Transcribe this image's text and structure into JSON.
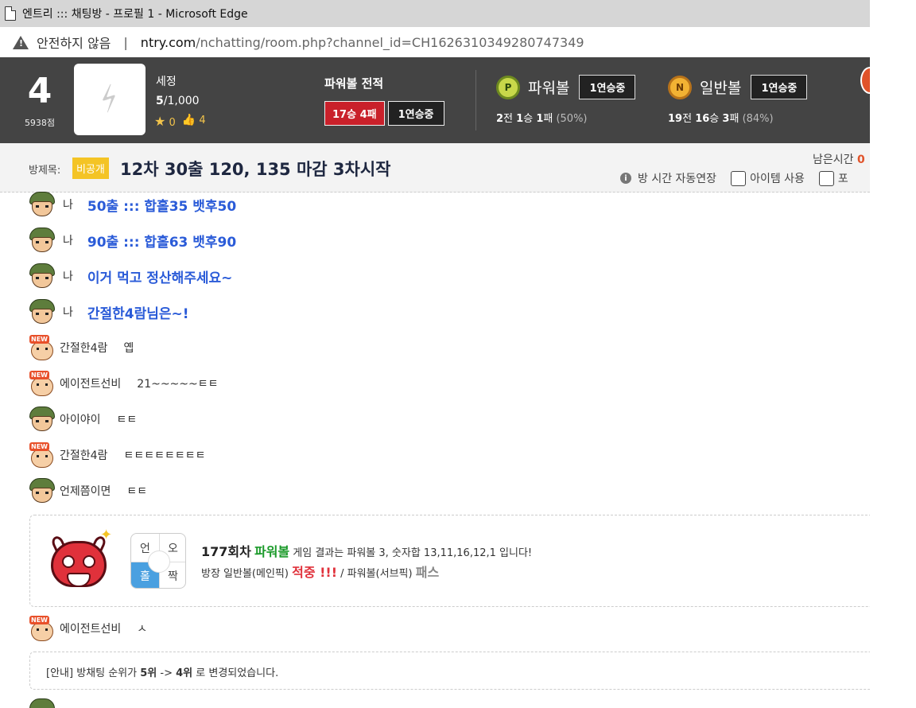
{
  "browser": {
    "window_title": "엔트리 ::: 채팅방 - 프로필 1 - Microsoft Edge",
    "security_label": "안전하지 않음",
    "separator": "|",
    "url_host": "ntry.com",
    "url_path": "/nchatting/room.php?channel_id=CH1626310349280747349"
  },
  "header": {
    "level": "4",
    "points": "5938점",
    "username": "세정",
    "count_current": "5",
    "count_rest": "/1,000",
    "stars": "0",
    "likes": "4",
    "powerball_record_title": "파워볼 전적",
    "powerball_record": "17승 4패",
    "powerball_streak": "1연승중",
    "games": [
      {
        "name": "파워볼",
        "coin": "P",
        "streak": "1연승중",
        "games": "2",
        "games_suffix": "전",
        "wins": "1",
        "wins_suffix": "승",
        "losses": "1",
        "losses_suffix": "패",
        "pct": "(50%)"
      },
      {
        "name": "일반볼",
        "coin": "N",
        "streak": "1연승중",
        "games": "19",
        "games_suffix": "전",
        "wins": "16",
        "wins_suffix": "승",
        "losses": "3",
        "losses_suffix": "패",
        "pct": "(84%)"
      }
    ]
  },
  "room": {
    "label": "방제목:",
    "privacy": "비공개",
    "title": "12차 30출 120, 135 마감 3차시작",
    "time_label": "남은시간",
    "time_value": "0",
    "auto_extend": "방 시간 자동연장",
    "item_use": "아이템 사용",
    "cut_option": "포"
  },
  "messages": [
    {
      "avatar": "soldier",
      "nick": "나",
      "text": "50출 ::: 합홀35 뱃후50",
      "style": "big"
    },
    {
      "avatar": "soldier",
      "nick": "나",
      "text": "90출 ::: 합홀63 뱃후90",
      "style": "big"
    },
    {
      "avatar": "soldier",
      "nick": "나",
      "text": "이거 먹고 정산해주세요~",
      "style": "big"
    },
    {
      "avatar": "soldier",
      "nick": "나",
      "text": "간절한4람님은~!",
      "style": "big"
    },
    {
      "avatar": "newbie",
      "nick": "간절한4람",
      "text": "옙",
      "style": "normal"
    },
    {
      "avatar": "newbie",
      "nick": "에이전트선비",
      "text": "21~~~~~ㅌㅌ",
      "style": "normal"
    },
    {
      "avatar": "soldier",
      "nick": "아이야이",
      "text": "ㅌㅌ",
      "style": "normal"
    },
    {
      "avatar": "newbie",
      "nick": "간절한4람",
      "text": "ㅌㅌㅌㅌㅌㅌㅌㅌ",
      "style": "normal"
    },
    {
      "avatar": "soldier",
      "nick": "언제쯤이면",
      "text": "ㅌㅌ",
      "style": "normal"
    }
  ],
  "new_badge": "NEW",
  "game_result": {
    "grid": [
      "언",
      "오",
      "홀",
      "짝"
    ],
    "round": "177회차",
    "game": "파워볼",
    "line1_rest": "게임 결과는 파워볼 3, 숫자합 13,11,16,12,1 입니다!",
    "line2_a": "방장 일반볼(메인픽)",
    "hit": "적중 !!!",
    "line2_b": "/ 파워볼(서브픽)",
    "pass": "패스"
  },
  "after_message": {
    "avatar": "newbie",
    "nick": "에이전트선비",
    "text": "ㅅ"
  },
  "notice": {
    "prefix": "[안내] 방채팅 순위가",
    "from": "5위",
    "arrow": "->",
    "to": "4위",
    "suffix": "로 변경되었습니다."
  }
}
